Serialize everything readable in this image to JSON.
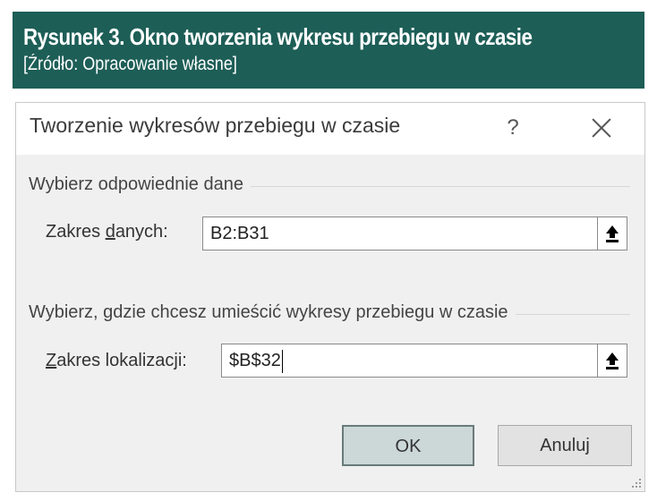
{
  "figure": {
    "title": "Rysunek 3. Okno tworzenia wykresu przebiegu w czasie",
    "source": "[Źródło: Opracowanie własne]",
    "header_color": "#1d5e57"
  },
  "dialog": {
    "title": "Tworzenie wykresów przebiegu w czasie",
    "help_label": "?",
    "close_icon": "close-icon",
    "group_data": {
      "label": "Wybierz odpowiednie dane",
      "field_label_pre": "Zakres ",
      "field_label_ul": "d",
      "field_label_post": "anych:",
      "value": "B2:B31"
    },
    "group_location": {
      "label": "Wybierz, gdzie chcesz umieścić wykresy przebiegu w czasie",
      "field_label_ul": "Z",
      "field_label_post": "akres lokalizacji:",
      "value": "$B$32"
    },
    "ok_label": "OK",
    "cancel_label": "Anuluj"
  }
}
